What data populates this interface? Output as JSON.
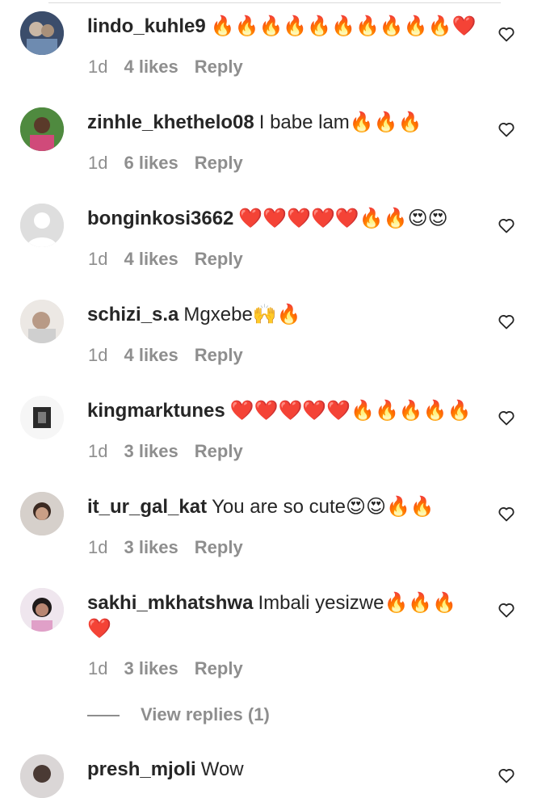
{
  "comments": [
    {
      "username": "lindo_kuhle9",
      "text": "🔥🔥🔥🔥🔥🔥🔥🔥🔥🔥❤️",
      "time": "1d",
      "likes": "4 likes",
      "reply": "Reply"
    },
    {
      "username": "zinhle_khethelo08",
      "text": "I babe lam🔥🔥🔥",
      "time": "1d",
      "likes": "6 likes",
      "reply": "Reply"
    },
    {
      "username": "bonginkosi3662",
      "text": "❤️❤️❤️❤️❤️🔥🔥😍😍",
      "time": "1d",
      "likes": "4 likes",
      "reply": "Reply"
    },
    {
      "username": "schizi_s.a",
      "text": "Mgxebe🙌🔥",
      "time": "1d",
      "likes": "4 likes",
      "reply": "Reply"
    },
    {
      "username": "kingmarktunes",
      "text": "❤️❤️❤️❤️❤️🔥🔥🔥🔥🔥",
      "time": "1d",
      "likes": "3 likes",
      "reply": "Reply"
    },
    {
      "username": "it_ur_gal_kat",
      "text": "You are so cute😍😍🔥🔥",
      "time": "1d",
      "likes": "3 likes",
      "reply": "Reply"
    },
    {
      "username": "sakhi_mkhatshwa",
      "text": "Imbali yesizwe🔥🔥🔥",
      "text_line2": "❤️",
      "time": "1d",
      "likes": "3 likes",
      "reply": "Reply"
    },
    {
      "username": "presh_mjoli",
      "text": "Wow"
    }
  ],
  "view_replies": "View replies (1)",
  "icons": {
    "like": "heart-outline-icon",
    "avatar": "profile-avatar"
  },
  "colors": {
    "username": "#262626",
    "meta": "#8e8e8e",
    "background": "#ffffff"
  }
}
